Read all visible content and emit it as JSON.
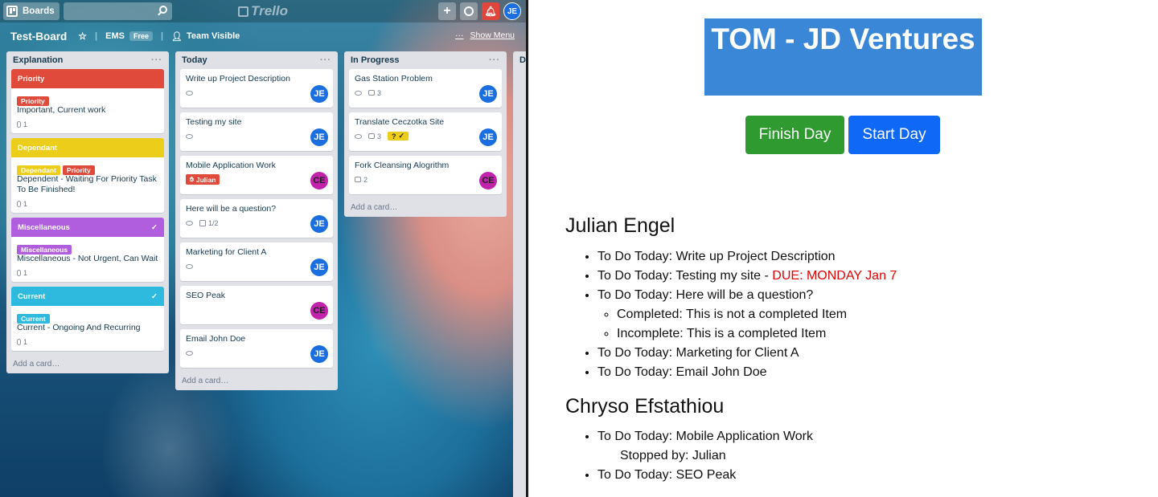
{
  "trello": {
    "boards_label": "Boards",
    "logo_text": "Trello",
    "user_initials": "JE",
    "board_name": "Test-Board",
    "team_name": "EMS",
    "team_plan": "Free",
    "visibility": "Team Visible",
    "show_menu": "Show Menu",
    "menu_dots": "···",
    "add_card": "Add a card…",
    "partial_list_letter": "D",
    "lists": [
      {
        "name": "Explanation",
        "cards": [
          {
            "bar": "Priority",
            "chips": [
              "Priority"
            ],
            "title": "Important, Current work",
            "attachments": "1"
          },
          {
            "bar": "Dependant",
            "chips": [
              "Dependant",
              "Priority"
            ],
            "title": "Dependent - Waiting For Priority Task To Be Finished!",
            "attachments": "1"
          },
          {
            "bar": "Miscellaneous",
            "chips": [
              "Miscellaneous"
            ],
            "title": "Miscellaneous - Not Urgent, Can Wait",
            "attachments": "1"
          },
          {
            "bar": "Current",
            "chips": [
              "Current"
            ],
            "title": "Current - Ongoing And Recurring",
            "attachments": "1"
          }
        ]
      },
      {
        "name": "Today",
        "cards": [
          {
            "title": "Write up Project Description",
            "member": "JE"
          },
          {
            "title": "Testing my site",
            "member": "JE"
          },
          {
            "title": "Mobile Application Work",
            "member": "CE",
            "tag": "Julian"
          },
          {
            "title": "Here will be a question?",
            "member": "JE",
            "checklist": "1/2"
          },
          {
            "title": "Marketing for Client A",
            "member": "JE"
          },
          {
            "title": "SEO Peak",
            "member": "CE"
          },
          {
            "title": "Email John Doe",
            "member": "JE"
          }
        ]
      },
      {
        "name": "In Progress",
        "cards": [
          {
            "title": "Gas Station Problem",
            "member": "JE",
            "comments": "3"
          },
          {
            "title": "Translate Ceczotka Site",
            "member": "JE",
            "comments": "3",
            "flag": "?"
          },
          {
            "title": "Fork Cleansing Alogrithm",
            "member": "CE",
            "comments": "2"
          }
        ]
      }
    ]
  },
  "report": {
    "title": "TOM - JD Ventures",
    "finish_button": "Finish Day",
    "start_button": "Start Day",
    "people": [
      {
        "name": "Julian Engel",
        "tasks": [
          "To Do Today: Write up Project Description",
          "To Do Today: Testing my site -",
          "To Do Today: Here will be a question?",
          "To Do Today: Marketing for Client A",
          "To Do Today: Email John Doe"
        ],
        "due": "DUE: MONDAY Jan 7",
        "subitems": [
          "Completed: This is not a completed Item",
          "Incomplete: This is a completed Item"
        ]
      },
      {
        "name": "Chryso Efstathiou",
        "tasks": [
          "To Do Today: Mobile Application Work",
          "To Do Today: SEO Peak"
        ],
        "stopped_by": "Stopped by: Julian"
      }
    ]
  },
  "colors": {
    "priority": "#e04a3b",
    "dependant": "#eccd1a",
    "miscellaneous": "#b05dde",
    "current": "#2eb9df",
    "title_box": "#3a87d8",
    "finish_button": "#2e9a30",
    "start_button": "#1068f7",
    "due_text": "#e30000"
  }
}
